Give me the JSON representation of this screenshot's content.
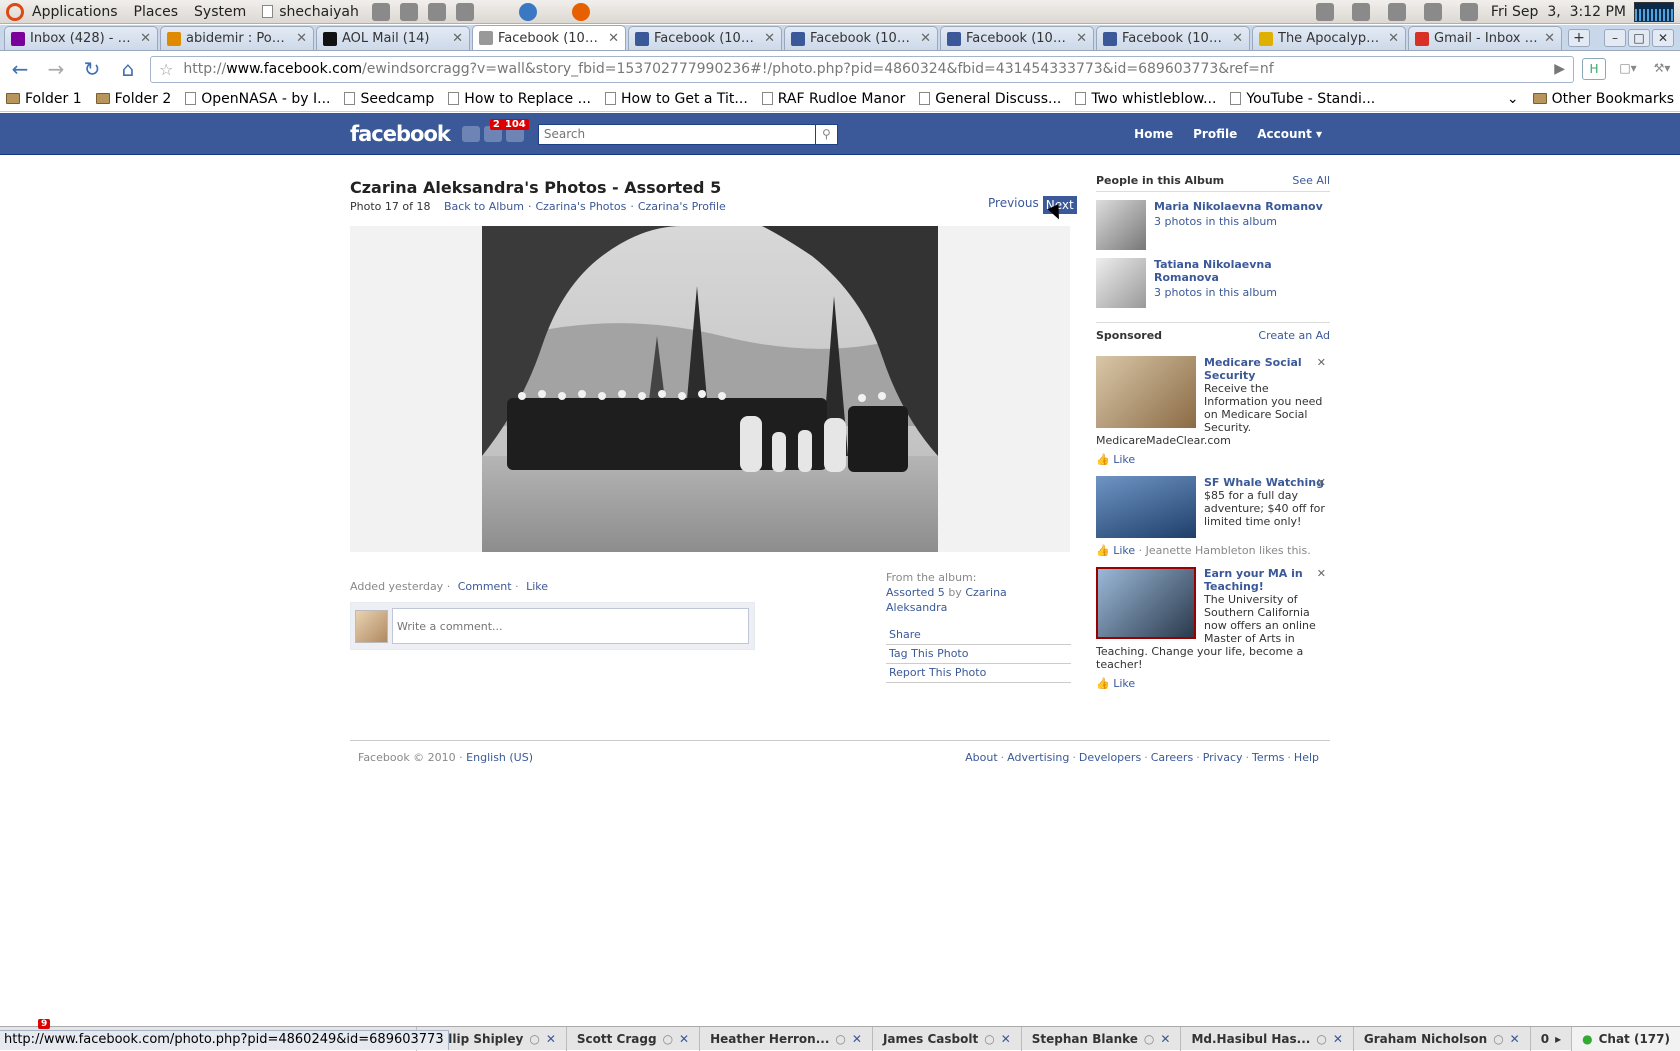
{
  "panel": {
    "menus": [
      "Applications",
      "Places",
      "System"
    ],
    "user": "shechaiyah",
    "clock": "Fri Sep  3,  3:12 PM"
  },
  "tabs": [
    {
      "title": "Inbox (428) - Y...",
      "favicon": "yahoo-icon",
      "color": "#7b0099"
    },
    {
      "title": "abidemir : Post...",
      "favicon": "page-icon",
      "color": "#e08a00"
    },
    {
      "title": "AOL Mail (14)",
      "favicon": "aol-icon",
      "color": "#111111"
    },
    {
      "title": "Facebook (106...",
      "favicon": "page-icon",
      "color": "#999999"
    },
    {
      "title": "Facebook (105...",
      "favicon": "facebook-icon",
      "color": "#3b5998"
    },
    {
      "title": "Facebook (106...",
      "favicon": "facebook-icon",
      "color": "#3b5998"
    },
    {
      "title": "Facebook (106...",
      "favicon": "facebook-icon",
      "color": "#3b5998"
    },
    {
      "title": "Facebook (106)...",
      "favicon": "facebook-icon",
      "color": "#3b5998"
    },
    {
      "title": "The Apocalyps...",
      "favicon": "page-icon",
      "color": "#e0b000"
    },
    {
      "title": "Gmail - Inbox (...",
      "favicon": "gmail-icon",
      "color": "#d93025"
    }
  ],
  "address": {
    "scheme": "http://",
    "host": "www.facebook.com",
    "path": "/ewindsorcragg?v=wall&story_fbid=153702777990236#!/photo.php?pid=4860324&fbid=431454333773&id=689603773&ref=nf"
  },
  "bookmarks": [
    {
      "label": "Folder 1",
      "type": "folder"
    },
    {
      "label": "Folder 2",
      "type": "folder"
    },
    {
      "label": "OpenNASA - by I...",
      "type": "page"
    },
    {
      "label": "Seedcamp",
      "type": "page"
    },
    {
      "label": "How to Replace ...",
      "type": "page"
    },
    {
      "label": "How to Get a Tit...",
      "type": "page"
    },
    {
      "label": "RAF Rudloe Manor",
      "type": "page"
    },
    {
      "label": "General Discuss...",
      "type": "page"
    },
    {
      "label": "Two whistleblow...",
      "type": "page"
    },
    {
      "label": "YouTube - Standi...",
      "type": "page"
    }
  ],
  "other_bookmarks": "Other Bookmarks",
  "fb": {
    "logo": "facebook",
    "badges": [
      "2",
      "104"
    ],
    "search_placeholder": "Search",
    "nav": [
      "Home",
      "Profile",
      "Account ▾"
    ]
  },
  "photo": {
    "title": "Czarina Aleksandra's Photos - Assorted 5",
    "counter": "Photo 17 of 18",
    "back": "Back to Album",
    "photos_link": "Czarina's Photos",
    "profile_link": "Czarina's Profile",
    "previous": "Previous",
    "next": "Next",
    "added": "Added yesterday ·",
    "comment": "Comment",
    "like": "Like",
    "comment_placeholder": "Write a comment...",
    "from_album": "From the album:",
    "album_name": "Assorted 5",
    "by": "by",
    "owner": "Czarina Aleksandra",
    "actions": [
      "Share",
      "Tag This Photo",
      "Report This Photo"
    ]
  },
  "people": {
    "heading": "People in this Album",
    "see_all": "See All",
    "items": [
      {
        "name": "Maria Nikolaevna Romanov",
        "count": "3 photos in this album"
      },
      {
        "name": "Tatiana Nikolaevna Romanova",
        "count": "3 photos in this album"
      }
    ]
  },
  "sponsored": {
    "heading": "Sponsored",
    "create": "Create an Ad",
    "ads": [
      {
        "title": "Medicare Social Security",
        "body": "Receive the Information you need on Medicare Social Security.",
        "domain": "MedicareMadeClear.com",
        "like": "Like",
        "social": ""
      },
      {
        "title": "SF Whale Watching",
        "body": "$85 for a full day adventure; $40 off for limited time only!",
        "domain": "",
        "like": "Like",
        "social": "· Jeanette Hambleton likes this."
      },
      {
        "title": "Earn your MA in Teaching!",
        "body": "The University of Southern California now offers an online Master of Arts in Teaching. Change your life, become a teacher!",
        "domain": "",
        "like": "Like",
        "social": ""
      }
    ]
  },
  "footer": {
    "copyright": "Facebook © 2010 ·",
    "language": "English (US)",
    "links": [
      "About",
      "Advertising",
      "Developers",
      "Careers",
      "Privacy",
      "Terms",
      "Help"
    ]
  },
  "chat": {
    "friends": [
      "Phillip Shipley",
      "Scott Cragg",
      "Heather Herron...",
      "James Casbolt",
      "Stephan Blanke",
      "Md.Hasibul Has...",
      "Graham Nicholson"
    ],
    "count_label": "0",
    "chat_label": "Chat (177)",
    "notif": "9"
  },
  "status_url": "http://www.facebook.com/photo.php?pid=4860249&id=689603773"
}
